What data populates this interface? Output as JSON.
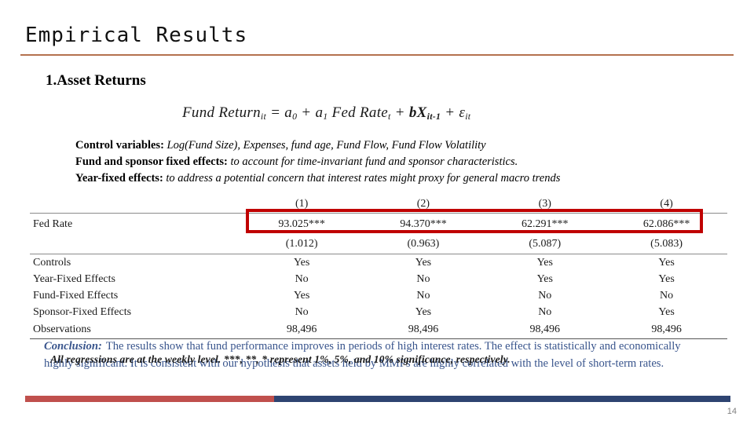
{
  "slide": {
    "title": "Empirical Results",
    "section_heading": "1.Asset Returns",
    "page_number": "14",
    "accent_color": "#b4714e",
    "highlight_color": "#c00000",
    "conclusion_color": "#38548c",
    "footer_bar_color": "#2e4471",
    "footer_accent_color": "#c0504d"
  },
  "equation": {
    "lhs": "Fund Return",
    "lhs_sub": "it",
    "eq": " = ",
    "a0": "a",
    "a0_sub": "0",
    "plus1": " + ",
    "a1": "a",
    "a1_sub": "1",
    "fedrate": " Fed Rate",
    "fedrate_sub": "t",
    "plus2": " + ",
    "bx": "bX",
    "bx_sub": "it-1",
    "plus3": " + ",
    "eps": "ε",
    "eps_sub": "it",
    "plain": "Fund Return_it = a_0 + a_1 Fed Rate_t + bX_it-1 + ε_it"
  },
  "spec_lines": [
    {
      "lead": "Control variables:",
      "tail": " Log(Fund Size), Expenses, fund age, Fund Flow, Fund Flow Volatility"
    },
    {
      "lead": "Fund and sponsor fixed effects:",
      "tail": " to account for time-invariant fund and sponsor characteristics."
    },
    {
      "lead": "Year-fixed effects:",
      "tail": " to address a potential concern that interest rates might proxy for general macro trends"
    }
  ],
  "table": {
    "column_headers": [
      "(1)",
      "(2)",
      "(3)",
      "(4)"
    ],
    "coefficient_label": "Fed Rate",
    "coefficients": [
      "93.025***",
      "94.370***",
      "62.291***",
      "62.086***"
    ],
    "standard_errors": [
      "(1.012)",
      "(0.963)",
      "(5.087)",
      "(5.083)"
    ],
    "rows": [
      {
        "label": "Controls",
        "values": [
          "Yes",
          "Yes",
          "Yes",
          "Yes"
        ]
      },
      {
        "label": "Year-Fixed Effects",
        "values": [
          "No",
          "No",
          "Yes",
          "Yes"
        ]
      },
      {
        "label": "Fund-Fixed Effects",
        "values": [
          "Yes",
          "No",
          "No",
          "No"
        ]
      },
      {
        "label": "Sponsor-Fixed Effects",
        "values": [
          "No",
          "Yes",
          "No",
          "Yes"
        ]
      },
      {
        "label": "Observations",
        "values": [
          "98,496",
          "98,496",
          "98,496",
          "98,496"
        ]
      }
    ]
  },
  "conclusion": {
    "lead": "Conclusion:",
    "text": "The results show that fund performance improves in periods of high interest rates. The effect is statistically and economically highly significant. It is consistent with our hypothesis that assets held by MMFs are highly correlated with the level of short-term rates."
  },
  "footnote": {
    "text": "All regressions are at the weekly level. ***, **, * represent 1%, 5%, and 10% significance, respectively."
  }
}
